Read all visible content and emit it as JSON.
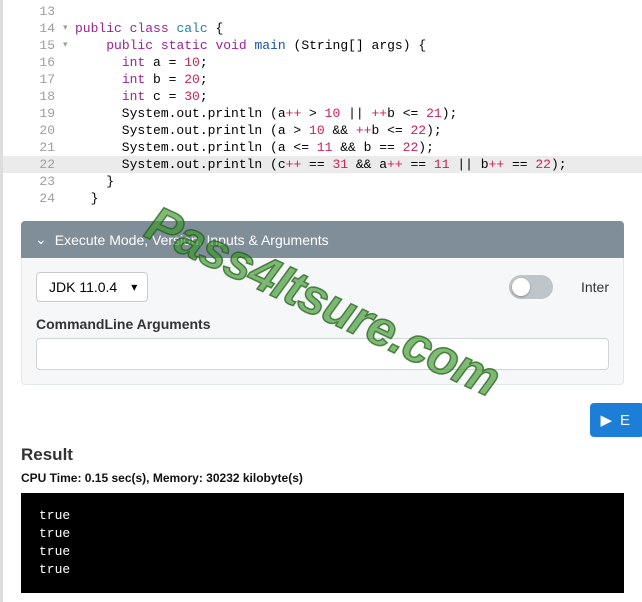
{
  "code": {
    "lines": [
      {
        "n": 13,
        "fold": "",
        "hl": false,
        "html": ""
      },
      {
        "n": 14,
        "fold": "▾",
        "hl": false,
        "html": "<span class='kw'>public</span> <span class='kw'>class</span> <span class='cls'>calc</span> {"
      },
      {
        "n": 15,
        "fold": "▾",
        "hl": false,
        "html": "    <span class='kw'>public</span> <span class='kw'>static</span> <span class='kw'>void</span> <span class='var'>main</span> (String[] args) {"
      },
      {
        "n": 16,
        "fold": "",
        "hl": false,
        "html": "      <span class='type'>int</span> a = <span class='num'>10</span>;"
      },
      {
        "n": 17,
        "fold": "",
        "hl": false,
        "html": "      <span class='type'>int</span> b = <span class='num'>20</span>;"
      },
      {
        "n": 18,
        "fold": "",
        "hl": false,
        "html": "      <span class='type'>int</span> c = <span class='num'>30</span>;"
      },
      {
        "n": 19,
        "fold": "",
        "hl": false,
        "html": "      System.out.println (a<span class='num'>++</span> &gt; <span class='num'>10</span> || <span class='num'>++</span>b &lt;= <span class='num'>21</span>);"
      },
      {
        "n": 20,
        "fold": "",
        "hl": false,
        "html": "      System.out.println (a &gt; <span class='num'>10</span> &amp;&amp; <span class='num'>++</span>b &lt;= <span class='num'>22</span>);"
      },
      {
        "n": 21,
        "fold": "",
        "hl": false,
        "html": "      System.out.println (a &lt;= <span class='num'>11</span> &amp;&amp; b == <span class='num'>22</span>);"
      },
      {
        "n": 22,
        "fold": "",
        "hl": true,
        "html": "      System.out.println (c<span class='num'>++</span> == <span class='num'>31</span> &amp;&amp; a<span class='num'>++</span> == <span class='num'>11</span> || b<span class='num'>++</span> == <span class='num'>22</span>);"
      },
      {
        "n": 23,
        "fold": "",
        "hl": false,
        "html": "    }"
      },
      {
        "n": 24,
        "fold": "",
        "hl": false,
        "html": "  }"
      }
    ]
  },
  "panel": {
    "title": "Execute Mode, Version, Inputs & Arguments",
    "jdk": "JDK 11.0.4",
    "toggle_label": "Inter",
    "cla_label": "CommandLine Arguments",
    "cla_value": ""
  },
  "exec_btn": "E",
  "result": {
    "heading": "Result",
    "cpu": "CPU Time: 0.15 sec(s), Memory: 30232 kilobyte(s)",
    "output": "true\ntrue\ntrue\ntrue"
  },
  "watermark": "Pass4Itsure.com"
}
